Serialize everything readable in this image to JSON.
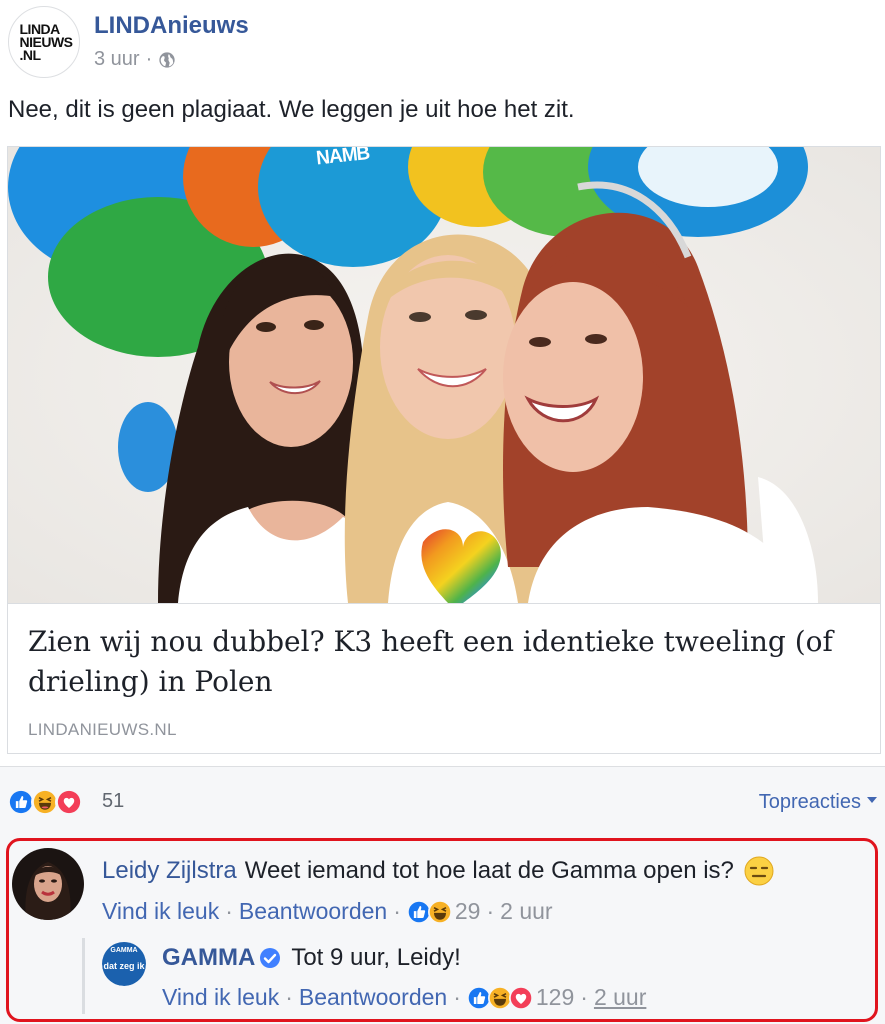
{
  "post": {
    "page_name": "LINDAnieuws",
    "page_logo": "LINDA NIEUWS .NL",
    "time": "3 uur",
    "separator": "·",
    "privacy_icon": "globe-icon",
    "text": "Nee, dit is geen plagiaat. We leggen je uit hoe het zit."
  },
  "link_card": {
    "title": "Zien wij nou dubbel? K3 heeft een identieke tweeling (of drieling) in Polen",
    "domain": "LINDANIEUWS.NL",
    "image_alt": "three smiling young women in white tops in front of colourful balloons"
  },
  "reactions": {
    "icons": [
      "like-icon",
      "haha-icon",
      "love-icon"
    ],
    "count": "51",
    "sort_label": "Topreacties"
  },
  "comment": {
    "author": "Leidy Zijlstra",
    "text": "Weet iemand tot hoe laat de Gamma open is?",
    "emoji": "expressionless-face-icon",
    "like_label": "Vind ik leuk",
    "reply_label": "Beantwoorden",
    "reaction_count": "29",
    "time": "2 uur"
  },
  "reply": {
    "author": "GAMMA",
    "avatar_text": "dat zeg ik",
    "avatar_brand": "GAMMA",
    "verified_icon": "verified-badge-icon",
    "text": "Tot 9 uur, Leidy!",
    "like_label": "Vind ik leuk",
    "reply_label": "Beantwoorden",
    "reaction_count": "129",
    "time": "2 uur"
  },
  "colors": {
    "link_blue": "#365899",
    "action_blue": "#4267b2",
    "muted_grey": "#90949c",
    "highlight_red": "#e0141e",
    "like_blue": "#1877f2",
    "love_red": "#f33e58",
    "haha_yellow": "#f7b125"
  }
}
